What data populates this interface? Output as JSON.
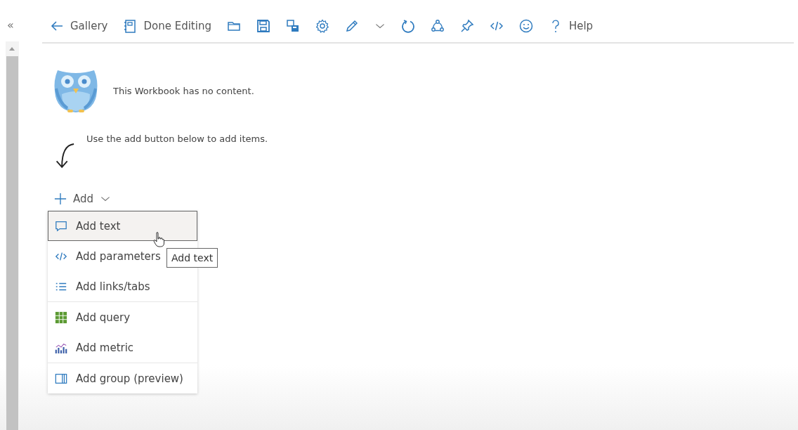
{
  "sidebar": {
    "collapse_icon": "«"
  },
  "toolbar": [
    {
      "kind": "back",
      "label": "Gallery"
    },
    {
      "kind": "notebook",
      "label": "Done Editing"
    },
    {
      "kind": "folder"
    },
    {
      "kind": "save"
    },
    {
      "kind": "save-as"
    },
    {
      "kind": "gear"
    },
    {
      "kind": "pencil"
    },
    {
      "kind": "chevron"
    },
    {
      "kind": "refresh"
    },
    {
      "kind": "share"
    },
    {
      "kind": "pin"
    },
    {
      "kind": "code"
    },
    {
      "kind": "smiley"
    },
    {
      "kind": "question",
      "label": "Help"
    }
  ],
  "empty_state": {
    "message": "This Workbook has no content.",
    "hint": "Use the add button below to add items."
  },
  "add_button": {
    "label": "Add"
  },
  "add_menu": {
    "groups": [
      [
        {
          "kind": "comment",
          "label": "Add text",
          "selected": true
        },
        {
          "kind": "code",
          "label": "Add parameters",
          "selected": false
        },
        {
          "kind": "list",
          "label": "Add links/tabs",
          "selected": false
        }
      ],
      [
        {
          "kind": "grid",
          "label": "Add query",
          "selected": false
        },
        {
          "kind": "metric",
          "label": "Add metric",
          "selected": false
        }
      ],
      [
        {
          "kind": "group",
          "label": "Add group (preview)",
          "selected": false
        }
      ]
    ]
  },
  "tooltip": {
    "text": "Add text"
  }
}
